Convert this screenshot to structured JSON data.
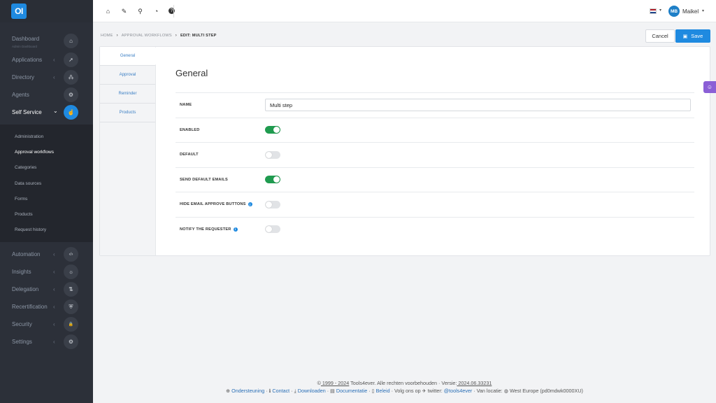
{
  "app": {
    "logo": "OI"
  },
  "sidebar": {
    "items": [
      {
        "label": "Dashboard",
        "sub": "Admin Dashboard",
        "icon": "home-icon",
        "glyph": "⌂"
      },
      {
        "label": "Applications",
        "chev": "‹",
        "icon": "rocket-icon",
        "glyph": "➚"
      },
      {
        "label": "Directory",
        "chev": "‹",
        "icon": "sitemap-icon",
        "glyph": "⁂"
      },
      {
        "label": "Agents",
        "icon": "cogs-icon",
        "glyph": "⚙"
      },
      {
        "label": "Self Service",
        "chev": "⌄",
        "icon": "hand-pointer-icon",
        "glyph": "☝"
      }
    ],
    "submenu": [
      "Administration",
      "Approval workflows",
      "Categories",
      "Data sources",
      "Forms",
      "Products",
      "Request history"
    ],
    "items_after": [
      {
        "label": "Automation",
        "chev": "‹",
        "icon": "code-icon",
        "glyph": "‹/›"
      },
      {
        "label": "Insights",
        "chev": "‹",
        "icon": "lightbulb-icon",
        "glyph": "☼"
      },
      {
        "label": "Delegation",
        "chev": "‹",
        "icon": "delegation-icon",
        "glyph": "⇅"
      },
      {
        "label": "Recertification",
        "chev": "‹",
        "icon": "shield-icon",
        "glyph": "⛨"
      },
      {
        "label": "Security",
        "chev": "‹",
        "icon": "lock-icon",
        "glyph": "🔒"
      },
      {
        "label": "Settings",
        "chev": "‹",
        "icon": "gear-icon",
        "glyph": "⚙"
      }
    ]
  },
  "topbar": {
    "icons": [
      {
        "name": "home-icon",
        "glyph": "⌂"
      },
      {
        "name": "wrench-icon",
        "glyph": "✎"
      },
      {
        "name": "network-icon",
        "glyph": "⚲"
      },
      {
        "name": "pie-chart-icon",
        "glyph": "◔"
      },
      {
        "name": "question-icon",
        "glyph": "?"
      }
    ],
    "flag_colors": [
      "#ae1c28",
      "#ffffff",
      "#21468b"
    ],
    "avatar_initials": "MB",
    "user_name": "Maikel"
  },
  "breadcrumb": {
    "home": "HOME",
    "section": "APPROVAL WORKFLOWS",
    "current": "EDIT: MULTI STEP",
    "separator": "›"
  },
  "actions": {
    "cancel": "Cancel",
    "save": "Save"
  },
  "tabs": [
    "General",
    "Approval",
    "Reminder",
    "Products"
  ],
  "form": {
    "title": "General",
    "name_label": "NAME",
    "name_value": "Multi step",
    "toggles": [
      {
        "label": "ENABLED",
        "on": true,
        "info": false
      },
      {
        "label": "DEFAULT",
        "on": false,
        "info": false
      },
      {
        "label": "SEND DEFAULT EMAILS",
        "on": true,
        "info": false
      },
      {
        "label": "HIDE EMAIL APPROVE BUTTONS",
        "on": false,
        "info": true
      },
      {
        "label": "NOTIFY THE REQUESTER",
        "on": false,
        "info": true
      }
    ]
  },
  "footer": {
    "copyright": "©",
    "years": " 1999 - 2024",
    "company": " Tools4ever. Alle rechten voorbehouden · Versie:",
    "version": " 2024.06.33231",
    "support": "Ondersteuning",
    "contact": "Contact",
    "downloads": "Downloaden",
    "docs": "Documentatie",
    "policy": "Beleid",
    "follow": "Volg ons op",
    "twitter": "twitter:",
    "handle": "@tools4ever",
    "location_label": "Van locatie:",
    "location": "West Europe (pd0mdwk0000XU)"
  }
}
